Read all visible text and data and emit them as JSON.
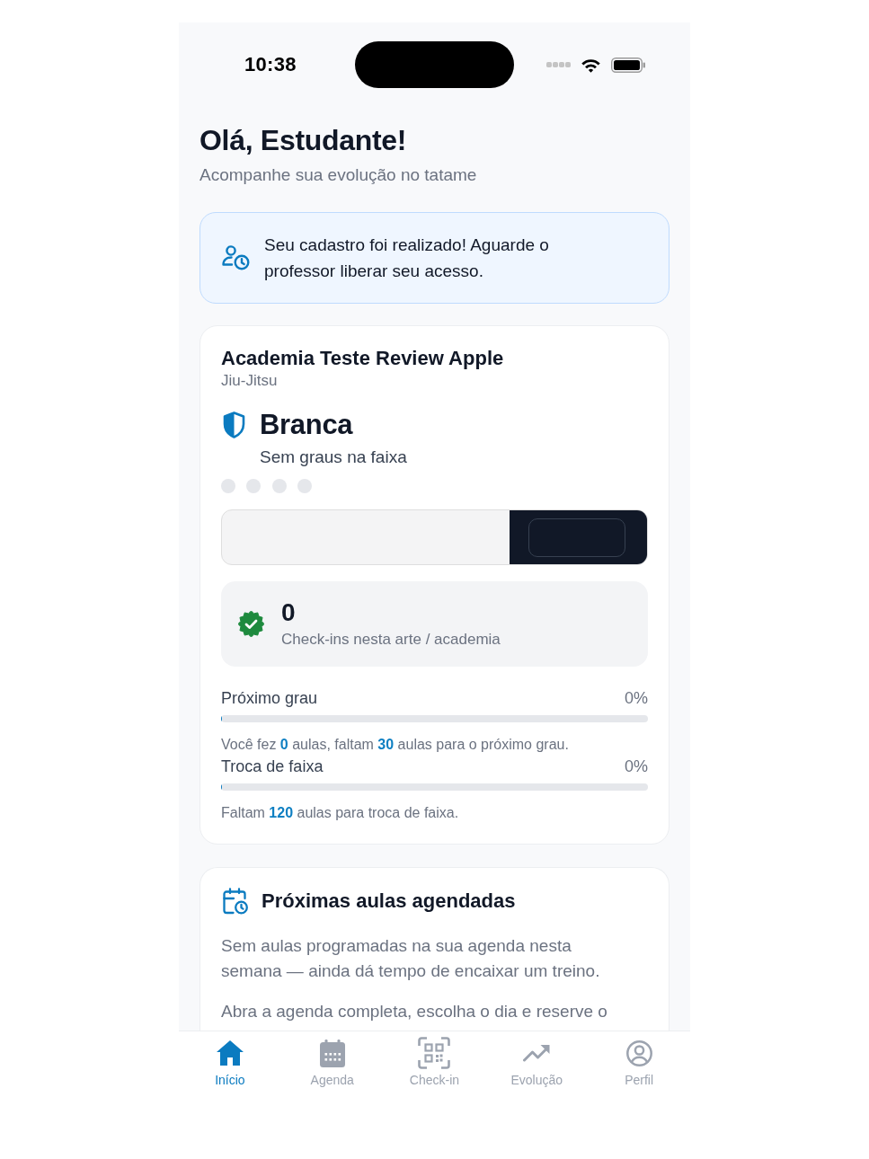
{
  "status_bar": {
    "time": "10:38"
  },
  "header": {
    "title": "Olá, Estudante!",
    "subtitle": "Acompanhe sua evolução no tatame"
  },
  "notice": {
    "text": "Seu cadastro foi realizado! Aguarde o professor liberar seu acesso."
  },
  "academy_card": {
    "name": "Academia Teste Review Apple",
    "martial_art": "Jiu-Jitsu",
    "belt": {
      "name": "Branca",
      "degrees_text": "Sem graus na faixa",
      "degrees": [
        {
          "earned": false
        },
        {
          "earned": false
        },
        {
          "earned": false
        },
        {
          "earned": false
        }
      ]
    },
    "checkins": {
      "count": "0",
      "label": "Check-ins nesta arte / academia"
    },
    "progress": [
      {
        "label": "Próximo grau",
        "reading": "0%",
        "level": 0,
        "note": "Você fez **0** aulas, faltam **30** aulas para o próximo grau."
      },
      {
        "label": "Troca de faixa",
        "reading": "0%",
        "level": 0,
        "note": "Faltam **120** aulas para troca de faixa."
      }
    ]
  },
  "schedule_card": {
    "title": "Próximas aulas agendadas",
    "paragraphs": [
      "Sem aulas programadas na sua agenda nesta semana — ainda dá tempo de encaixar um treino.",
      "Abra a agenda completa, escolha o dia e reserve o"
    ]
  },
  "tabs": [
    {
      "label": "Início",
      "selected": true
    },
    {
      "label": "Agenda",
      "selected": false
    },
    {
      "label": "Check-in",
      "selected": false
    },
    {
      "label": "Evolução",
      "selected": false
    },
    {
      "label": "Perfil",
      "selected": false
    }
  ]
}
